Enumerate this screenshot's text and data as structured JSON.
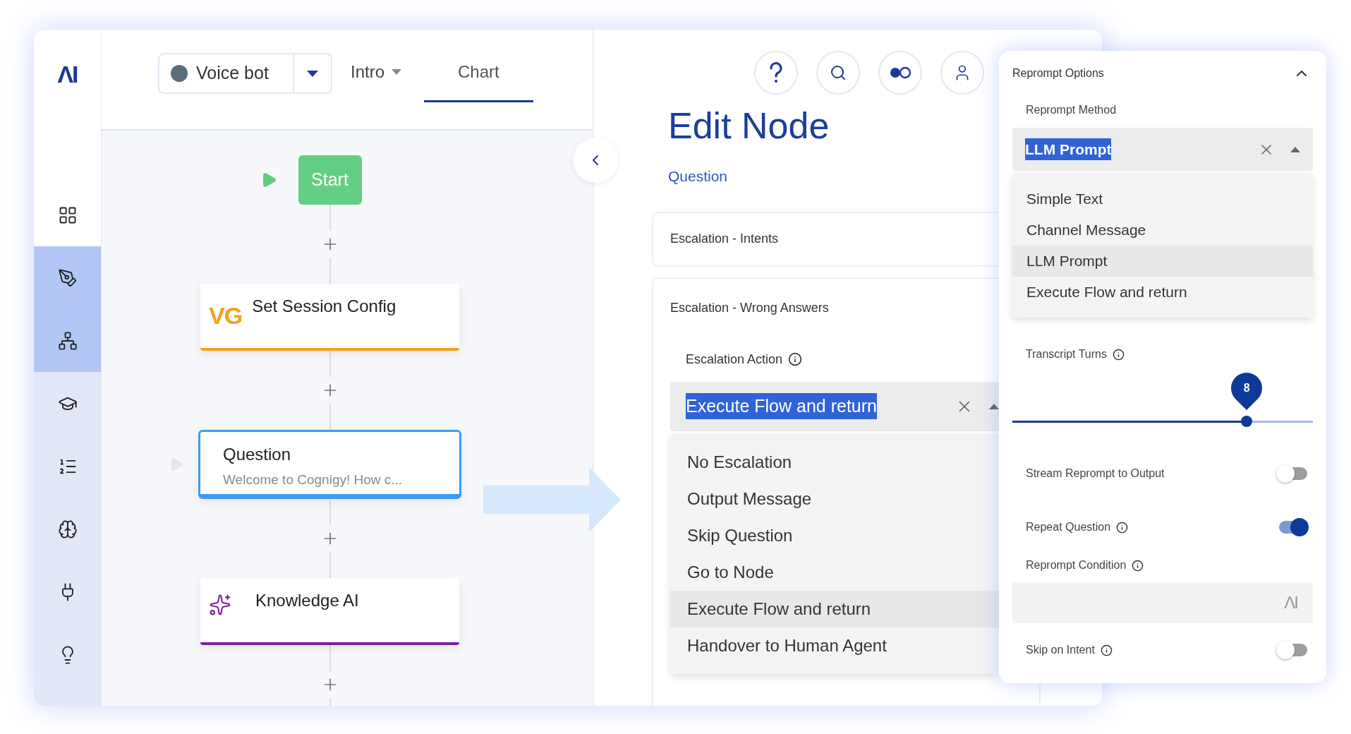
{
  "logo": "ΛI",
  "sidebar": {
    "items": [
      {
        "selected": false
      },
      {
        "selected": true
      },
      {
        "selected": true
      },
      {
        "selected": false
      },
      {
        "selected": false
      },
      {
        "selected": false
      },
      {
        "selected": false
      },
      {
        "selected": false
      }
    ]
  },
  "header": {
    "bot_selector": {
      "label": "Voice bot"
    },
    "tabs": [
      {
        "label": "Intro",
        "kind": "dropdown",
        "selected": false
      },
      {
        "label": "Chart",
        "kind": "plain",
        "selected": true
      }
    ]
  },
  "flow": {
    "nodes": [
      {
        "kind": "start",
        "title": "Start"
      },
      {
        "kind": "badge_card",
        "badge": "VG",
        "title": "Set Session Config",
        "color": "#f5a11f",
        "selected": false
      },
      {
        "kind": "plain_card",
        "title": "Question",
        "subtitle": "Welcome to Cognigy! How c...",
        "color": "#3d9bf7",
        "selected": true
      },
      {
        "kind": "sparkle_card",
        "title": "Knowledge AI",
        "color": "#7e1fa0",
        "selected": false
      }
    ]
  },
  "edit_node": {
    "title": "Edit Node",
    "subtitle": "Question",
    "sections": [
      {
        "title": "Escalation - Intents"
      },
      {
        "title": "Escalation - Wrong Answers",
        "field": {
          "label": "Escalation Action",
          "value": "Execute Flow and return",
          "options": [
            {
              "label": "No Escalation",
              "selected": false
            },
            {
              "label": "Output Message",
              "selected": false
            },
            {
              "label": "Skip Question",
              "selected": false
            },
            {
              "label": "Go to Node",
              "selected": false
            },
            {
              "label": "Execute Flow and return",
              "selected": true
            },
            {
              "label": "Handover to Human Agent",
              "selected": false
            }
          ]
        }
      }
    ]
  },
  "reprompt": {
    "title": "Reprompt Options",
    "expanded": true,
    "method": {
      "label": "Reprompt Method",
      "value": "LLM Prompt",
      "options": [
        {
          "label": "Simple Text",
          "selected": false
        },
        {
          "label": "Channel Message",
          "selected": false
        },
        {
          "label": "LLM Prompt",
          "selected": true
        },
        {
          "label": "Execute Flow and return",
          "selected": false
        }
      ]
    },
    "transcript_turns": {
      "label": "Transcript Turns",
      "value": "8",
      "level": 0.78
    },
    "settings": [
      {
        "kind": "toggle",
        "label": "Stream Reprompt to Output",
        "info": false,
        "on": false
      },
      {
        "kind": "toggle",
        "label": "Repeat Question",
        "info": true,
        "on": true
      },
      {
        "kind": "field",
        "label": "Reprompt Condition",
        "info": true,
        "badge": "ΛI"
      },
      {
        "kind": "toggle",
        "label": "Skip on Intent",
        "info": true,
        "on": false
      }
    ]
  }
}
